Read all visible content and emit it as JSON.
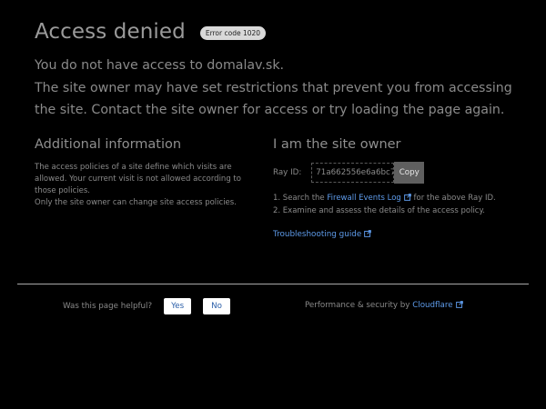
{
  "header": {
    "title": "Access denied",
    "error_badge": "Error code 1020"
  },
  "intro": {
    "line1": "You do not have access to domalav.sk.",
    "line2": "The site owner may have set restrictions that prevent you from accessing the site. Contact the site owner for access or try loading the page again."
  },
  "additional": {
    "title": "Additional information",
    "para1": "The access policies of a site define which visits are allowed. Your current visit is not allowed according to those policies.",
    "para2": "Only the site owner can change site access policies."
  },
  "owner": {
    "title": "I am the site owner",
    "ray_label": "Ray ID:",
    "ray_value": "71a662556e6a6bc7",
    "copy_label": "Copy",
    "step1_prefix": "1. Search the ",
    "step1_link": "Firewall Events Log",
    "step1_suffix": " for the above Ray ID.",
    "step2": "2. Examine and assess the details of the access policy.",
    "troubleshooting": "Troubleshooting guide"
  },
  "footer": {
    "helpful_question": "Was this page helpful?",
    "yes_label": "Yes",
    "no_label": "No",
    "perf_prefix": "Performance & security by ",
    "cloudflare_link": "Cloudflare"
  },
  "colors": {
    "background": "#000000",
    "link": "#5e9bea",
    "badge": "#d9d9d9"
  },
  "icons": {
    "external_link": "external-link-icon"
  }
}
